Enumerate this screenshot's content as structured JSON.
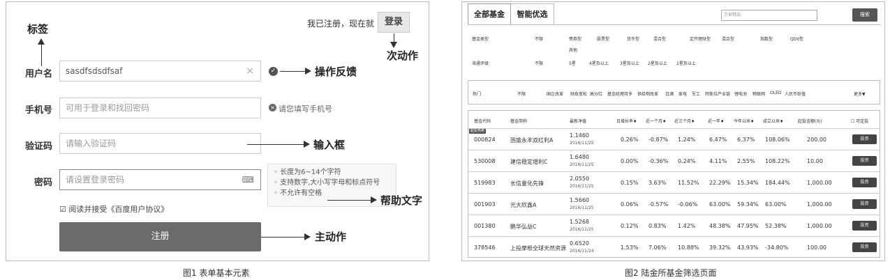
{
  "fig1": {
    "caption": "图1 表单基本元素",
    "annotations": {
      "tag": "标签",
      "secondary_action": "次动作",
      "feedback": "操作反馈",
      "input_box": "输入框",
      "help_text": "帮助文字",
      "primary_action": "主动作"
    },
    "registered_text": "我已注册，现在就",
    "login_label": "登录",
    "fields": {
      "username_label": "用户名",
      "username_value": "sasdfsdsdfsaf",
      "phone_label": "手机号",
      "phone_placeholder": "可用于登录和找回密码",
      "phone_error": "请您填写手机号",
      "code_label": "验证码",
      "code_placeholder": "请输入验证码",
      "password_label": "密码",
      "password_placeholder": "请设置登录密码"
    },
    "help_items": [
      "长度为6~14个字符",
      "支持数字,大小写字母和标点符号",
      "不允许有空格"
    ],
    "agreement": "阅读并接受《百度用户协议》",
    "register_label": "注册"
  },
  "fig2": {
    "caption": "图2 陆金所基金筛选页面",
    "tabs": [
      "全部基金",
      "智能优选"
    ],
    "search_placeholder": "万家精选",
    "search_button": "搜索",
    "filters": {
      "type_label": "基金类型",
      "types": [
        "不限",
        "债券型",
        "股票型",
        "货币型",
        "混合型",
        "定开理财型",
        "混合型",
        "指数型",
        "QDII型"
      ],
      "other_type": "其他",
      "rating_label": "海通评级",
      "ratings": [
        "不限",
        "5星",
        "4星及以上",
        "3星及以上",
        "2星及以上",
        "1星及以上"
      ]
    },
    "hot": {
      "label": "热门",
      "items": [
        "不限",
        "国企改革",
        "财政宽松",
        "高分红",
        "基金经理持多",
        "供给侧改革",
        "白酒",
        "家电",
        "军工",
        "特斯拉产业链",
        "锂电池",
        "物联网",
        "OLED",
        "人民币贬值"
      ],
      "more": "更多▼"
    },
    "table": {
      "headers": [
        "基金代码",
        "基金简称",
        "最新净值",
        "日增长率♦",
        "近一个月♦",
        "近三个月♦",
        "近一年♦",
        "今年以来♦",
        "成立以来♦",
        "起投金额(元)",
        "可定投"
      ],
      "badge": "起投热卖",
      "invest_label": "投资",
      "rows": [
        {
          "code": "000824",
          "name": "国盛永丰双红利A",
          "nav": "1.1460",
          "date": "2016/11/25",
          "day": "0.26%",
          "m1": "-0.87%",
          "m3": "1.24%",
          "y1": "6.47%",
          "ytd": "6.37%",
          "since": "108.06%",
          "min": "200.00"
        },
        {
          "code": "530008",
          "name": "建信稳定增利C",
          "nav": "1.6480",
          "date": "2016/11/25",
          "day": "0.00%",
          "m1": "-0.36%",
          "m3": "0.24%",
          "y1": "4.11%",
          "ytd": "2.55%",
          "since": "108.22%",
          "min": "10.00"
        },
        {
          "code": "519983",
          "name": "长信量化先锋",
          "nav": "2.0550",
          "date": "2016/11/25",
          "day": "0.15%",
          "m1": "3.63%",
          "m3": "11.52%",
          "y1": "22.29%",
          "ytd": "15.34%",
          "since": "184.44%",
          "min": "1,000.00"
        },
        {
          "code": "001903",
          "name": "光大欣鑫A",
          "nav": "1.5660",
          "date": "2016/11/25",
          "day": "0.06%",
          "m1": "-0.57%",
          "m3": "-0.06%",
          "y1": "63.00%",
          "ytd": "59.34%",
          "since": "63.00%",
          "min": "1,000.00"
        },
        {
          "code": "001380",
          "name": "鹏华弘益C",
          "nav": "1.5268",
          "date": "2016/11/25",
          "day": "0.12%",
          "m1": "0.83%",
          "m3": "1.42%",
          "y1": "48.38%",
          "ytd": "47.95%",
          "since": "52.38%",
          "min": "1,000.00"
        },
        {
          "code": "378546",
          "name": "上投摩根全球天然资源",
          "nav": "0.6520",
          "date": "2016/11/24",
          "day": "1.53%",
          "m1": "7.06%",
          "m3": "10.88%",
          "y1": "39.32%",
          "ytd": "43.93%",
          "since": "-34.80%",
          "min": "100.00"
        }
      ]
    }
  }
}
